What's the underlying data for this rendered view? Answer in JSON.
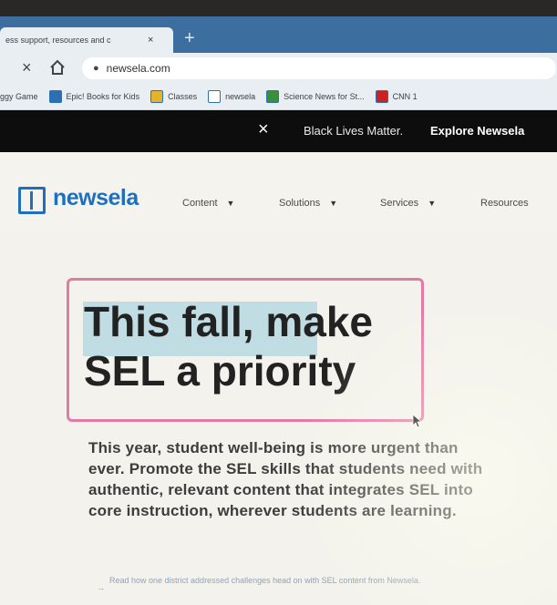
{
  "browser": {
    "tab_title": "ess support, resources and c",
    "tab_close": "×",
    "new_tab": "+",
    "url": "newsela.com",
    "back": "×",
    "lock": "🔒"
  },
  "bookmarks": [
    {
      "label": "ggy Game",
      "color": "#8fb0d6"
    },
    {
      "label": "Epic! Books for Kids",
      "color": "#2d6fb3"
    },
    {
      "label": "Classes",
      "color": "#e5b32b"
    },
    {
      "label": "newsela",
      "color": "#ffffff"
    },
    {
      "label": "Science News for St...",
      "color": "#3a8f3a"
    },
    {
      "label": "CNN 1",
      "color": "#cc2222"
    }
  ],
  "banner": {
    "close": "×",
    "text": "Black Lives Matter.",
    "link": "Explore Newsela"
  },
  "site": {
    "logo": "newsela",
    "nav": [
      "Content",
      "Solutions",
      "Services",
      "Resources"
    ]
  },
  "hero": {
    "title_line1": "This fall, make",
    "title_line2": "SEL a priority",
    "body": "This year, student well-being is more urgent than ever. Promote the SEL skills that students need with authentic, relevant content that integrates SEL into core instruction, wherever students are learning.",
    "note": "Read how one district addressed challenges head on with SEL content from Newsela."
  },
  "colors": {
    "accent": "#1f6fbf",
    "highlight_border": "#e37aa6",
    "banner_bg": "#0d0d0d"
  }
}
